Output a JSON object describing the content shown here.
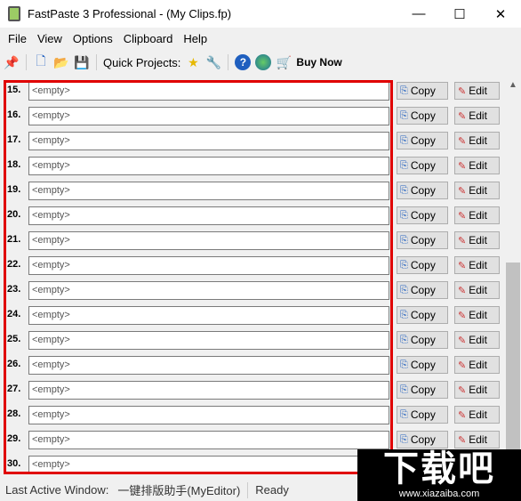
{
  "window": {
    "title": "FastPaste 3 Professional -  (My Clips.fp)",
    "minimize": "—",
    "maximize": "☐",
    "close": "✕"
  },
  "menu": [
    "File",
    "View",
    "Options",
    "Clipboard",
    "Help"
  ],
  "toolbar": {
    "quick_projects_label": "Quick Projects:",
    "buy_now": "Buy Now"
  },
  "clips": [
    {
      "num": "15.",
      "value": "<empty>"
    },
    {
      "num": "16.",
      "value": "<empty>"
    },
    {
      "num": "17.",
      "value": "<empty>"
    },
    {
      "num": "18.",
      "value": "<empty>"
    },
    {
      "num": "19.",
      "value": "<empty>"
    },
    {
      "num": "20.",
      "value": "<empty>"
    },
    {
      "num": "21.",
      "value": "<empty>"
    },
    {
      "num": "22.",
      "value": "<empty>"
    },
    {
      "num": "23.",
      "value": "<empty>"
    },
    {
      "num": "24.",
      "value": "<empty>"
    },
    {
      "num": "25.",
      "value": "<empty>"
    },
    {
      "num": "26.",
      "value": "<empty>"
    },
    {
      "num": "27.",
      "value": "<empty>"
    },
    {
      "num": "28.",
      "value": "<empty>"
    },
    {
      "num": "29.",
      "value": "<empty>"
    },
    {
      "num": "30.",
      "value": "<empty>"
    }
  ],
  "buttons": {
    "copy": "Copy",
    "edit": "Edit"
  },
  "status": {
    "label": "Last Active Window:",
    "window": "一键排版助手(MyEditor)",
    "state": "Ready"
  },
  "watermark": {
    "big": "下载吧",
    "small": "www.xiazaiba.com"
  },
  "colors": {
    "highlight": "#e00000"
  }
}
